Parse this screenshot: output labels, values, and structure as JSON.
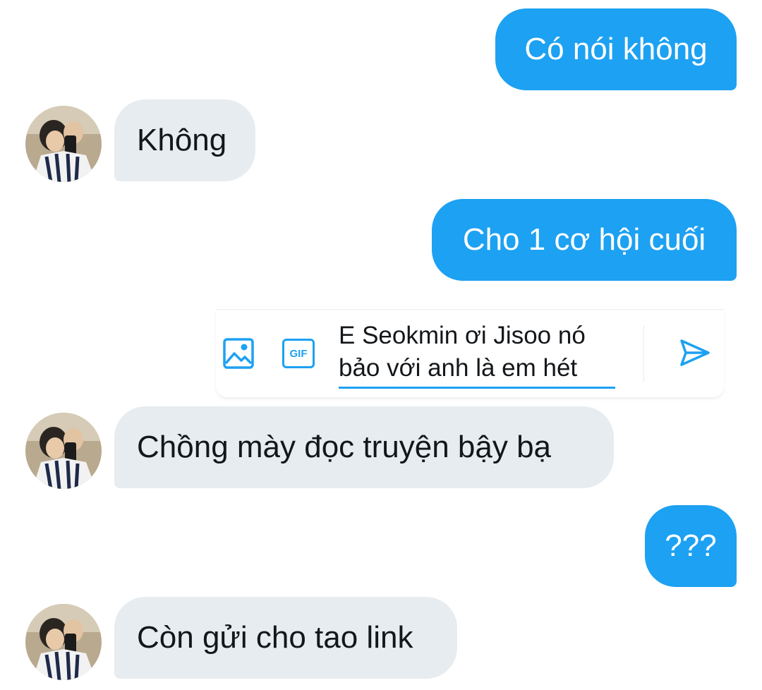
{
  "conversation": {
    "messages": [
      {
        "direction": "sent",
        "text": "Có nói không"
      },
      {
        "direction": "received",
        "text": "Không"
      },
      {
        "direction": "sent",
        "text": "Cho 1 cơ hội cuối"
      },
      {
        "direction": "received",
        "text": "Chồng mày đọc truyện bậy bạ"
      },
      {
        "direction": "sent",
        "text": "???"
      },
      {
        "direction": "received",
        "text": "Còn gửi cho tao link"
      }
    ]
  },
  "composer": {
    "draft_text": "E Seokmin ơi Jisoo nó bảo với anh là em hét",
    "gif_label": "GIF",
    "icons": [
      "image-icon",
      "gif-icon",
      "send-icon"
    ]
  },
  "colors": {
    "accent": "#1da1f2",
    "received_bubble": "#e6ecf0",
    "background": "#ffffff"
  }
}
